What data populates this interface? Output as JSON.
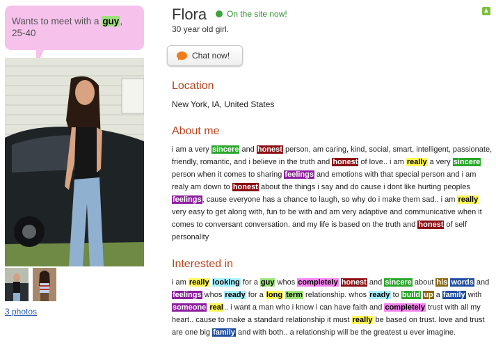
{
  "bubble": {
    "before": "Wants to meet with a ",
    "highlight": "guy",
    "after": ", 25-40"
  },
  "gallery": {
    "photos_link": "3 photos"
  },
  "profile": {
    "name": "Flora",
    "online_status": "On the site now!",
    "subtitle": "30 year old girl.",
    "chat_button": "Chat now!"
  },
  "location": {
    "title": "Location",
    "value": "New York, IA, United States"
  },
  "about": {
    "title": "About me",
    "segments": [
      [
        "i am a very ",
        null
      ],
      [
        "sincere",
        "green"
      ],
      [
        " and ",
        null
      ],
      [
        "honest",
        "darkred"
      ],
      [
        " person, am caring, kind, social, smart, intelligent, passionate, friendly, romantic, and i believe in the truth and ",
        null
      ],
      [
        "honest",
        "darkred"
      ],
      [
        " of love.. i am ",
        null
      ],
      [
        "really",
        "yellow"
      ],
      [
        " a very ",
        null
      ],
      [
        "sincere",
        "green"
      ],
      [
        " person when it comes to sharing ",
        null
      ],
      [
        "feelings",
        "purple"
      ],
      [
        " and emotions with that special person and i am realy am down to ",
        null
      ],
      [
        "honest",
        "darkred"
      ],
      [
        " about the things i say and do cause i dont like hurting peoples ",
        null
      ],
      [
        "feelings",
        "purple"
      ],
      [
        ", cause everyone has a chance to laugh, so why do i make them sad.. i am ",
        null
      ],
      [
        "really",
        "yellow"
      ],
      [
        " very easy to get along with, fun to be with and am very adaptive and communicative when it comes to conversant conversation. and my life is based on the truth and ",
        null
      ],
      [
        "honest",
        "darkred"
      ],
      [
        " of self personality",
        null
      ]
    ]
  },
  "interested": {
    "title": "Interested in",
    "segments": [
      [
        "i am ",
        null
      ],
      [
        "really",
        "yellow"
      ],
      [
        " ",
        null
      ],
      [
        "looking",
        "cyan"
      ],
      [
        " for a ",
        null
      ],
      [
        "guy",
        "lightgreen"
      ],
      [
        " whos ",
        null
      ],
      [
        "completely",
        "pink"
      ],
      [
        " ",
        null
      ],
      [
        "honest",
        "darkred"
      ],
      [
        " and ",
        null
      ],
      [
        "sincere",
        "green"
      ],
      [
        " about ",
        null
      ],
      [
        "his",
        "olive"
      ],
      [
        " ",
        null
      ],
      [
        "words",
        "navy"
      ],
      [
        " and ",
        null
      ],
      [
        "feelings",
        "purple"
      ],
      [
        " whos ",
        null
      ],
      [
        "ready",
        "cyan"
      ],
      [
        " for a ",
        null
      ],
      [
        "long",
        "yellow"
      ],
      [
        " ",
        null
      ],
      [
        "term",
        "lightgreen"
      ],
      [
        " relationship. whos ",
        null
      ],
      [
        "ready",
        "cyan"
      ],
      [
        " to ",
        null
      ],
      [
        "build",
        "green"
      ],
      [
        " ",
        null
      ],
      [
        "up",
        "olive"
      ],
      [
        " a ",
        null
      ],
      [
        "family",
        "navy"
      ],
      [
        " with ",
        null
      ],
      [
        "someone",
        "purple"
      ],
      [
        " ",
        null
      ],
      [
        "real",
        "yellow"
      ],
      [
        ".. i want a man who i know i can have faith and ",
        null
      ],
      [
        "completely",
        "pink"
      ],
      [
        " trust with all my heart.. cause to make a standard relationship it must ",
        null
      ],
      [
        "really",
        "yellow"
      ],
      [
        " be based on trust. love and trust are one big ",
        null
      ],
      [
        "family",
        "navy"
      ],
      [
        " and with both.. a relationship will be the greatest u ever imagine.",
        null
      ]
    ]
  },
  "colors": {
    "section_title": "#b5421a",
    "online": "#2f8f2f",
    "bubble": "#f6c2ec",
    "link": "#2a5db0",
    "highlights": {
      "green": {
        "bg": "#2aa62a",
        "fg": "#ffffff"
      },
      "lightgreen": {
        "bg": "#9ee27a",
        "fg": "#000000"
      },
      "darkred": {
        "bg": "#8b0f14",
        "fg": "#ffffff"
      },
      "yellow": {
        "bg": "#fff65a",
        "fg": "#000000"
      },
      "purple": {
        "bg": "#8d1f9e",
        "fg": "#ffffff"
      },
      "cyan": {
        "bg": "#a6f0ff",
        "fg": "#000000"
      },
      "pink": {
        "bg": "#f784f0",
        "fg": "#000000"
      },
      "olive": {
        "bg": "#8a6a12",
        "fg": "#ffffff"
      },
      "navy": {
        "bg": "#1f4ea0",
        "fg": "#ffffff"
      }
    }
  }
}
